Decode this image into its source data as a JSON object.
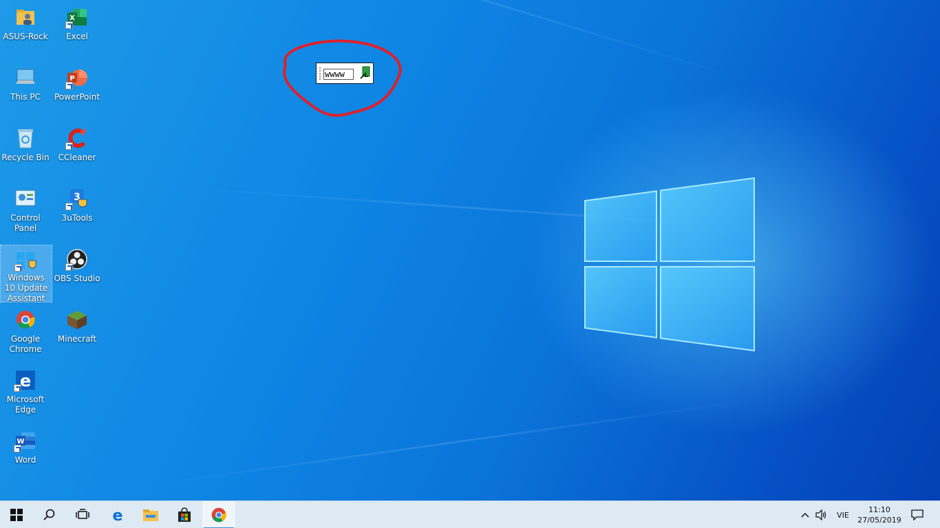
{
  "desktop": {
    "icons": [
      {
        "label": "ASUS-Rock",
        "icon": "user-folder-icon"
      },
      {
        "label": "Excel",
        "icon": "excel-icon"
      },
      {
        "label": "This PC",
        "icon": "computer-icon"
      },
      {
        "label": "PowerPoint",
        "icon": "powerpoint-icon"
      },
      {
        "label": "Recycle Bin",
        "icon": "recycle-bin-icon"
      },
      {
        "label": "CCleaner",
        "icon": "ccleaner-icon"
      },
      {
        "label": "Control Panel",
        "icon": "control-panel-icon"
      },
      {
        "label": "3uTools",
        "icon": "3utools-icon"
      },
      {
        "label": "Windows 10 Update Assistant",
        "icon": "windows-update-icon"
      },
      {
        "label": "OBS Studio",
        "icon": "obs-icon"
      },
      {
        "label": "Google Chrome",
        "icon": "chrome-icon"
      },
      {
        "label": "Minecraft",
        "icon": "minecraft-icon"
      },
      {
        "label": "Microsoft Edge",
        "icon": "edge-icon"
      },
      {
        "label": "Word",
        "icon": "word-icon"
      }
    ]
  },
  "ime_box": {
    "value": "wwww"
  },
  "taskbar": {
    "buttons": [
      {
        "icon": "windows-start-icon"
      },
      {
        "icon": "search-icon"
      },
      {
        "icon": "task-view-icon"
      },
      {
        "icon": "edge-icon"
      },
      {
        "icon": "file-explorer-icon"
      },
      {
        "icon": "store-icon"
      },
      {
        "icon": "chrome-icon",
        "active": true
      }
    ],
    "tray": {
      "language": "VIE",
      "time": "11:10",
      "date": "27/05/2019"
    }
  },
  "colors": {
    "taskbar_bg": "#dde9f3",
    "accent": "#3a8ee6",
    "annotation": "#e0202a"
  }
}
